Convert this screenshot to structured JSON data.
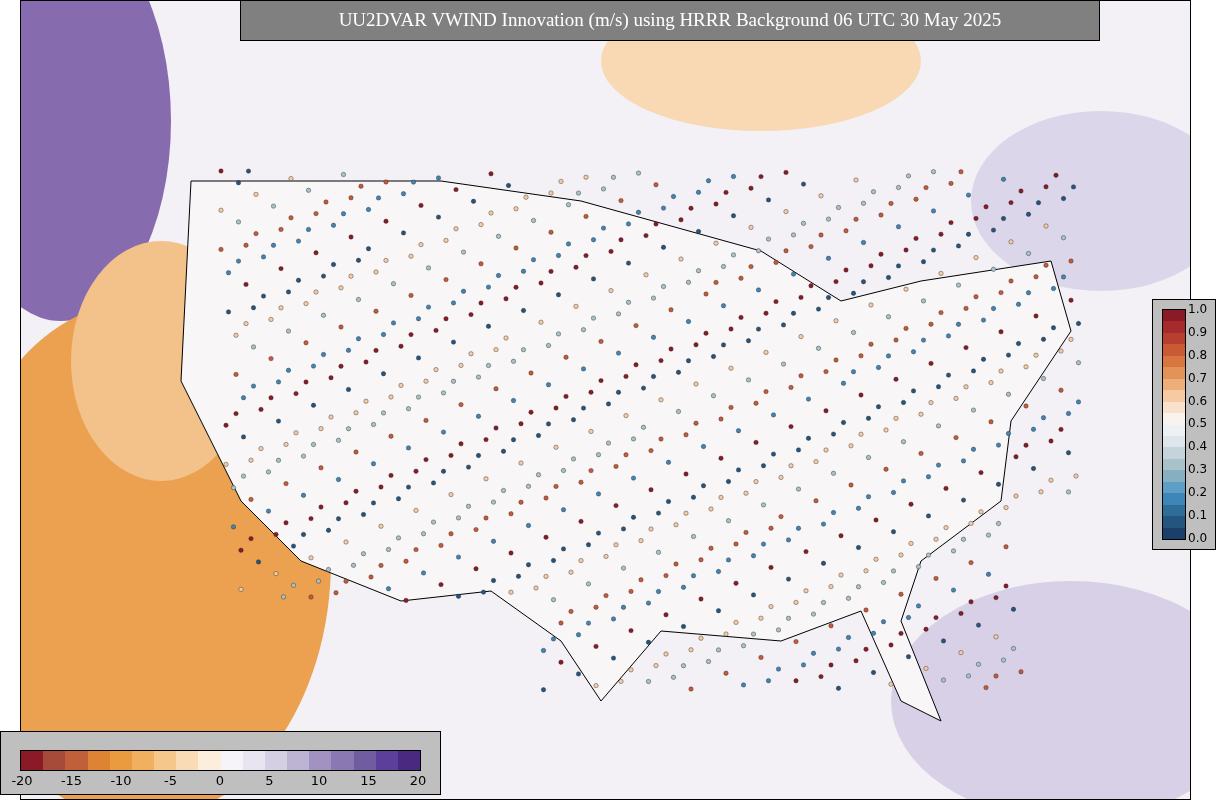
{
  "title": "UU2DVAR VWIND Innovation (m/s) using HRRR Background 06 UTC 30 May 2025",
  "probability_colorbar": {
    "labels": [
      "1.0",
      "0.9",
      "0.8",
      "0.7",
      "0.6",
      "0.5",
      "0.4",
      "0.3",
      "0.2",
      "0.1",
      "0.0"
    ]
  },
  "innovation_colorbar": {
    "labels": [
      "-20",
      "-15",
      "-10",
      "-5",
      "0",
      "5",
      "10",
      "15",
      "20"
    ]
  }
}
